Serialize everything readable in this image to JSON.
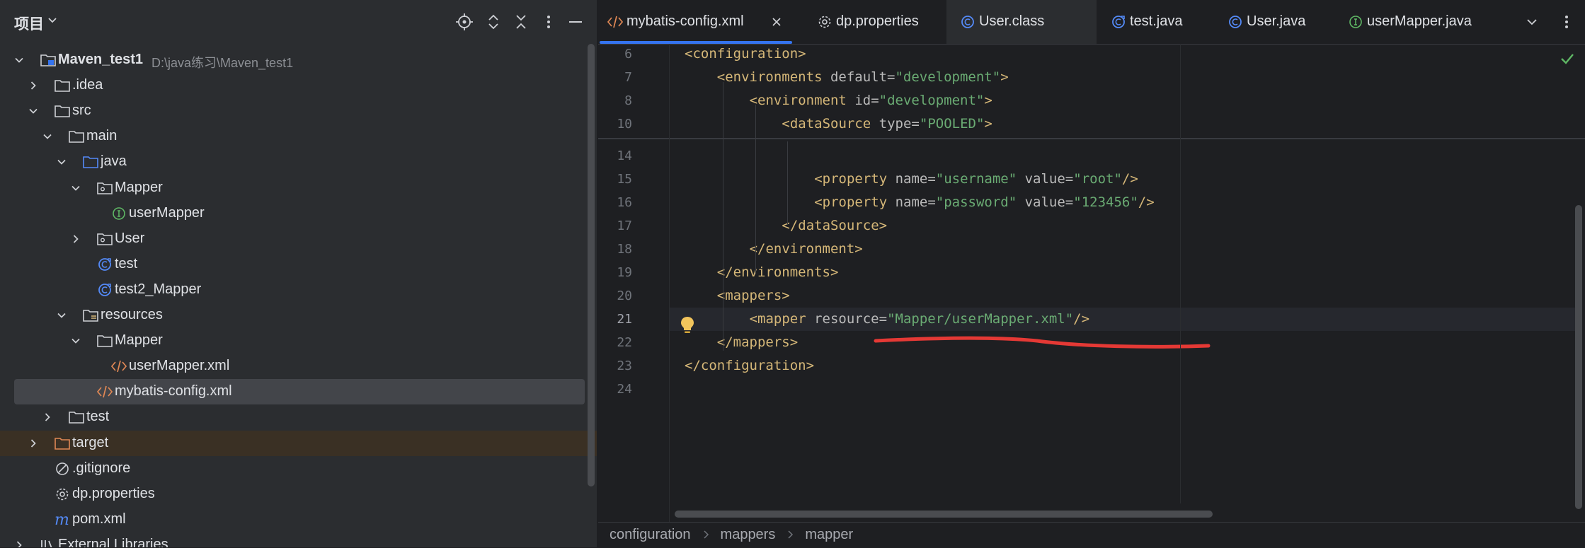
{
  "project_panel": {
    "title": "项目",
    "tree": [
      {
        "label": "Maven_test1",
        "path": "D:\\java练习\\Maven_test1",
        "icon": "module-folder-icon",
        "chevron": "down",
        "depth": 0,
        "bold": true
      },
      {
        "label": ".idea",
        "icon": "folder-icon",
        "chevron": "right",
        "depth": 1
      },
      {
        "label": "src",
        "icon": "folder-icon",
        "chevron": "down",
        "depth": 1
      },
      {
        "label": "main",
        "icon": "folder-icon",
        "chevron": "down",
        "depth": 2
      },
      {
        "label": "java",
        "icon": "source-folder-icon",
        "chevron": "down",
        "depth": 3
      },
      {
        "label": "Mapper",
        "icon": "package-icon",
        "chevron": "down",
        "depth": 4
      },
      {
        "label": "userMapper",
        "icon": "interface-icon",
        "chevron": "none",
        "depth": 5
      },
      {
        "label": "User",
        "icon": "package-icon",
        "chevron": "right",
        "depth": 4
      },
      {
        "label": "test",
        "icon": "java-class-icon",
        "chevron": "none",
        "depth": 4
      },
      {
        "label": "test2_Mapper",
        "icon": "java-class-icon",
        "chevron": "none",
        "depth": 4
      },
      {
        "label": "resources",
        "icon": "resources-folder-icon",
        "chevron": "down",
        "depth": 3
      },
      {
        "label": "Mapper",
        "icon": "folder-icon",
        "chevron": "down",
        "depth": 4
      },
      {
        "label": "userMapper.xml",
        "icon": "xml-file-icon",
        "chevron": "none",
        "depth": 5
      },
      {
        "label": "mybatis-config.xml",
        "icon": "xml-file-icon",
        "chevron": "none",
        "depth": 4,
        "selected": true
      },
      {
        "label": "test",
        "icon": "folder-icon",
        "chevron": "right",
        "depth": 2
      },
      {
        "label": "target",
        "icon": "excluded-folder-icon",
        "chevron": "right",
        "depth": 1,
        "excluded": true
      },
      {
        "label": ".gitignore",
        "icon": "gitignore-icon",
        "chevron": "none",
        "depth": 1
      },
      {
        "label": "dp.properties",
        "icon": "properties-icon",
        "chevron": "none",
        "depth": 1
      },
      {
        "label": "pom.xml",
        "icon": "maven-icon",
        "chevron": "none",
        "depth": 1
      },
      {
        "label": "External Libraries",
        "icon": "library-icon",
        "chevron": "right",
        "depth": 0
      }
    ]
  },
  "tabs": [
    {
      "label": "mybatis-config.xml",
      "icon": "xml-file-icon",
      "active": true,
      "closable": true
    },
    {
      "label": "dp.properties",
      "icon": "properties-icon"
    },
    {
      "label": "User.class",
      "icon": "class-icon",
      "highlight": true
    },
    {
      "label": "test.java",
      "icon": "java-class-icon"
    },
    {
      "label": "User.java",
      "icon": "class-icon"
    },
    {
      "label": "userMapper.java",
      "icon": "interface-icon"
    }
  ],
  "editor": {
    "current_line": "21",
    "lines": [
      {
        "n": "6",
        "indent": 0,
        "parts": [
          [
            "tag",
            "<configuration>"
          ]
        ]
      },
      {
        "n": "7",
        "indent": 1,
        "parts": [
          [
            "tag",
            "<environments "
          ],
          [
            "attr",
            "default="
          ],
          [
            "val",
            "\"development\""
          ],
          [
            "tag",
            ">"
          ]
        ]
      },
      {
        "n": "8",
        "indent": 2,
        "parts": [
          [
            "tag",
            "<environment "
          ],
          [
            "attr",
            "id="
          ],
          [
            "val",
            "\"development\""
          ],
          [
            "tag",
            ">"
          ]
        ]
      },
      {
        "n": "10",
        "indent": 3,
        "parts": [
          [
            "tag",
            "<dataSource "
          ],
          [
            "attr",
            "type="
          ],
          [
            "val",
            "\"POOLED\""
          ],
          [
            "tag",
            ">"
          ]
        ]
      },
      {
        "n": "14",
        "indent": 0,
        "parts": []
      },
      {
        "n": "15",
        "indent": 4,
        "parts": [
          [
            "tag",
            "<property "
          ],
          [
            "attr",
            "name="
          ],
          [
            "val",
            "\"username\""
          ],
          [
            "attr",
            " value="
          ],
          [
            "val",
            "\"root\""
          ],
          [
            "tag",
            "/>"
          ]
        ]
      },
      {
        "n": "16",
        "indent": 4,
        "parts": [
          [
            "tag",
            "<property "
          ],
          [
            "attr",
            "name="
          ],
          [
            "val",
            "\"password\""
          ],
          [
            "attr",
            " value="
          ],
          [
            "val",
            "\"123456\""
          ],
          [
            "tag",
            "/>"
          ]
        ]
      },
      {
        "n": "17",
        "indent": 3,
        "parts": [
          [
            "tag",
            "</dataSource>"
          ]
        ]
      },
      {
        "n": "18",
        "indent": 2,
        "parts": [
          [
            "tag",
            "</environment>"
          ]
        ]
      },
      {
        "n": "19",
        "indent": 1,
        "parts": [
          [
            "tag",
            "</environments>"
          ]
        ]
      },
      {
        "n": "20",
        "indent": 1,
        "parts": [
          [
            "tag",
            "<mappers>"
          ]
        ]
      },
      {
        "n": "21",
        "indent": 2,
        "parts": [
          [
            "tag",
            "<mapper "
          ],
          [
            "attr",
            "resource="
          ],
          [
            "val",
            "\"Mapper/userMapper.xml\""
          ],
          [
            "tag",
            "/>"
          ]
        ]
      },
      {
        "n": "22",
        "indent": 1,
        "parts": [
          [
            "tag",
            "</mappers>"
          ]
        ]
      },
      {
        "n": "23",
        "indent": 0,
        "parts": [
          [
            "tag",
            "</configuration>"
          ]
        ]
      },
      {
        "n": "24",
        "indent": 0,
        "parts": []
      }
    ]
  },
  "breadcrumbs": [
    "configuration",
    "mappers",
    "mapper"
  ],
  "colors": {
    "accent": "#3574f0",
    "xml_tag": "#d5b778",
    "xml_value": "#6aab73",
    "annotation_stroke": "#e53935",
    "inspection_ok": "#5fb865"
  }
}
